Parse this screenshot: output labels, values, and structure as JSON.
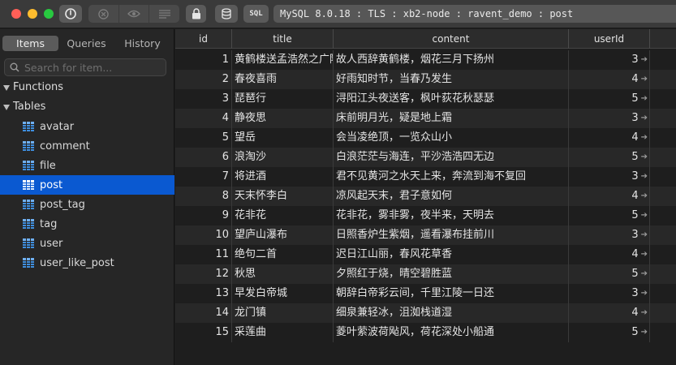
{
  "toolbar": {
    "connection": "MySQL 8.0.18 : TLS : xb2-node : ravent_demo : post",
    "sql_label": "SQL"
  },
  "sidebar": {
    "tabs": [
      "Items",
      "Queries",
      "History"
    ],
    "search_placeholder": "Search for item...",
    "functions_label": "Functions",
    "tables_label": "Tables",
    "tables": [
      "avatar",
      "comment",
      "file",
      "post",
      "post_tag",
      "tag",
      "user",
      "user_like_post"
    ],
    "selected": "post"
  },
  "grid": {
    "columns": [
      "id",
      "title",
      "content",
      "userId"
    ],
    "rows": [
      {
        "id": "1",
        "title": "黄鹤楼送孟浩然之广陵",
        "content": "故人西辞黄鹤楼，烟花三月下扬州",
        "userId": "3"
      },
      {
        "id": "2",
        "title": "春夜喜雨",
        "content": "好雨知时节，当春乃发生",
        "userId": "4"
      },
      {
        "id": "3",
        "title": "琵琶行",
        "content": "浔阳江头夜送客，枫叶荻花秋瑟瑟",
        "userId": "5"
      },
      {
        "id": "4",
        "title": "静夜思",
        "content": "床前明月光，疑是地上霜",
        "userId": "3"
      },
      {
        "id": "5",
        "title": "望岳",
        "content": "会当凌绝顶，一览众山小",
        "userId": "4"
      },
      {
        "id": "6",
        "title": "浪淘沙",
        "content": "白浪茫茫与海连，平沙浩浩四无边",
        "userId": "5"
      },
      {
        "id": "7",
        "title": "将进酒",
        "content": "君不见黄河之水天上来，奔流到海不复回",
        "userId": "3"
      },
      {
        "id": "8",
        "title": "天末怀李白",
        "content": "凉风起天末，君子意如何",
        "userId": "4"
      },
      {
        "id": "9",
        "title": "花非花",
        "content": "花非花，雾非雾，夜半来，天明去",
        "userId": "5"
      },
      {
        "id": "10",
        "title": "望庐山瀑布",
        "content": "日照香炉生紫烟，遥看瀑布挂前川",
        "userId": "3"
      },
      {
        "id": "11",
        "title": "绝句二首",
        "content": "迟日江山丽，春风花草香",
        "userId": "4"
      },
      {
        "id": "12",
        "title": "秋思",
        "content": "夕照红于烧，晴空碧胜蓝",
        "userId": "5"
      },
      {
        "id": "13",
        "title": "早发白帝城",
        "content": "朝辞白帝彩云间，千里江陵一日还",
        "userId": "3"
      },
      {
        "id": "14",
        "title": "龙门镇",
        "content": "细泉兼轻冰，沮洳栈道湿",
        "userId": "4"
      },
      {
        "id": "15",
        "title": "采莲曲",
        "content": "菱叶萦波荷飐风，荷花深处小船通",
        "userId": "5"
      }
    ]
  }
}
